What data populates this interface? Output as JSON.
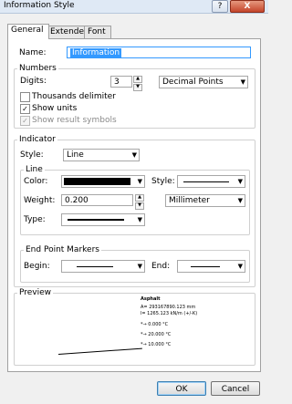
{
  "window": {
    "title": "Information Style",
    "help_glyph": "?",
    "close_glyph": "X"
  },
  "tabs": [
    {
      "label": "General"
    },
    {
      "label": "Extended"
    },
    {
      "label": "Font"
    }
  ],
  "name": {
    "label": "Name:",
    "value": "Information"
  },
  "numbers": {
    "title": "Numbers",
    "digits_label": "Digits:",
    "digits_value": "3",
    "format_value": "Decimal Points",
    "thousands_label": "Thousands delimiter",
    "show_units_label": "Show units",
    "show_result_label": "Show result symbols",
    "check_glyph": "✓"
  },
  "indicator": {
    "title": "Indicator",
    "style_label": "Style:",
    "style_value": "Line",
    "line_title": "Line",
    "color_label": "Color:",
    "style2_label": "Style:",
    "weight_label": "Weight:",
    "weight_value": "0.200",
    "unit_value": "Millimeter",
    "type_label": "Type:"
  },
  "endpoints": {
    "title": "End Point Markers",
    "begin_label": "Begin:",
    "end_label": "End:"
  },
  "preview": {
    "title": "Preview",
    "lines": [
      "Asphalt",
      "A= 293167890.123 mm",
      "l= 1265.123 kN/m (+/-K)",
      "*→ 0.000 °C",
      "*→ 20.000 °C",
      "*→ 10.000 °C"
    ]
  },
  "buttons": {
    "ok": "OK",
    "cancel": "Cancel"
  },
  "colors": {
    "accent": "#3399ff",
    "titlebar": "#dfe9f5",
    "close": "#c4442a"
  }
}
